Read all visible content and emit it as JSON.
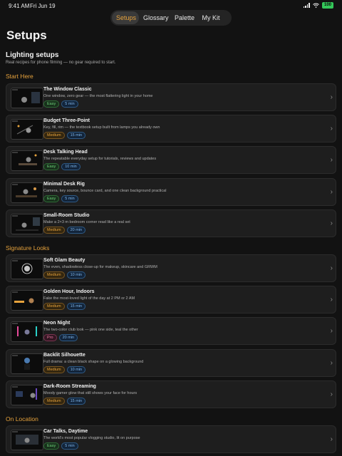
{
  "status": {
    "time": "9:41 AM",
    "date": "Fri Jun 19",
    "battery": "100"
  },
  "tabs": [
    {
      "label": "Setups",
      "active": true
    },
    {
      "label": "Glossary",
      "active": false
    },
    {
      "label": "Palette",
      "active": false
    },
    {
      "label": "My Kit",
      "active": false
    }
  ],
  "page": {
    "title": "Setups",
    "subtitle": "Lighting setups",
    "tagline": "Real recipes for phone filming — no gear required to start."
  },
  "sections": [
    {
      "label": "Start Here",
      "cards": [
        {
          "title": "The Window Classic",
          "desc": "One window, zero gear — the most flattering light in your home",
          "difficulty": "Easy",
          "level": "easy",
          "time": "5 min"
        },
        {
          "title": "Budget Three-Point",
          "desc": "Key, fill, rim — the textbook setup built from lamps you already own",
          "difficulty": "Medium",
          "level": "medium",
          "time": "15 min"
        },
        {
          "title": "Desk Talking Head",
          "desc": "The repeatable everyday setup for tutorials, reviews and updates",
          "difficulty": "Easy",
          "level": "easy",
          "time": "10 min"
        },
        {
          "title": "Minimal Desk Rig",
          "desc": "Camera, key source, bounce card, and one clean background practical",
          "difficulty": "Easy",
          "level": "easy",
          "time": "5 min"
        },
        {
          "title": "Small-Room Studio",
          "desc": "Make a 2×3 m bedroom corner read like a real set",
          "difficulty": "Medium",
          "level": "medium",
          "time": "20 min"
        }
      ]
    },
    {
      "label": "Signature Looks",
      "cards": [
        {
          "title": "Soft Glam Beauty",
          "desc": "The even, shadowless close-up for makeup, skincare and GRWM",
          "difficulty": "Medium",
          "level": "medium",
          "time": "10 min"
        },
        {
          "title": "Golden Hour, Indoors",
          "desc": "Fake the most-loved light of the day at 2 PM or 2 AM",
          "difficulty": "Medium",
          "level": "medium",
          "time": "15 min"
        },
        {
          "title": "Neon Night",
          "desc": "The two-color club look — pink one side, teal the other",
          "difficulty": "Pro",
          "level": "pro",
          "time": "20 min"
        },
        {
          "title": "Backlit Silhouette",
          "desc": "Full drama: a clean black shape on a glowing background",
          "difficulty": "Medium",
          "level": "medium",
          "time": "10 min"
        },
        {
          "title": "Dark-Room Streaming",
          "desc": "Moody gamer glow that still shows your face for hours",
          "difficulty": "Medium",
          "level": "medium",
          "time": "15 min"
        }
      ]
    },
    {
      "label": "On Location",
      "cards": [
        {
          "title": "Car Talks, Daytime",
          "desc": "The world's most popular vlogging studio, lit on purpose",
          "difficulty": "Easy",
          "level": "easy",
          "time": "5 min"
        }
      ]
    }
  ],
  "colors": {
    "accent": "#e6a23c",
    "easy": "#6fd07a",
    "pro": "#e87aa0",
    "time": "#7fb6ea"
  }
}
